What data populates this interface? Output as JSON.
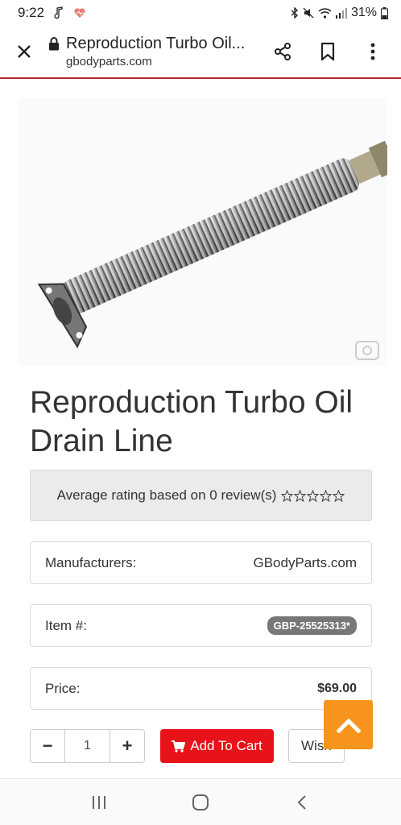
{
  "status_bar": {
    "time": "9:22",
    "battery": "31%"
  },
  "browser": {
    "page_title": "Reproduction Turbo Oil...",
    "domain": "gbodyparts.com"
  },
  "product": {
    "title": "Reproduction Turbo Oil Drain Line",
    "rating_text": "Average rating based on 0 review(s)",
    "rating_value": 0,
    "rating_max": 5,
    "manufacturer_label": "Manufacturers:",
    "manufacturer_value": "GBodyParts.com",
    "item_label": "Item #:",
    "item_value": "GBP-25525313*",
    "price_label": "Price:",
    "price_value": "$69.00",
    "quantity": "1"
  },
  "actions": {
    "minus": "−",
    "plus": "+",
    "add_to_cart": "Add To Cart",
    "wish": "Wish"
  },
  "colors": {
    "accent_red": "#e8121b",
    "scroll_top_orange": "#f7941d",
    "header_line": "#b3262b"
  }
}
